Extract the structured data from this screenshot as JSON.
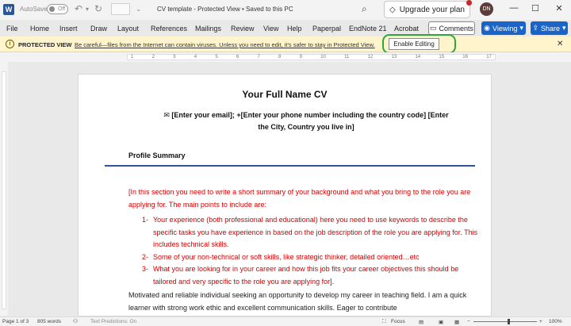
{
  "titlebar": {
    "app_logo": "W",
    "autosave_label": "AutoSave",
    "autosave_state": "Off",
    "undo_icon": "undo-icon",
    "redo_icon": "redo-icon",
    "doc_title": "CV template  -  Protected View  •  Saved to this PC",
    "upgrade_label": "Upgrade your plan",
    "avatar_initials": "DN",
    "minimize": "—",
    "maximize": "☐",
    "close": "✕"
  },
  "ribbon": {
    "tabs": [
      "File",
      "Home",
      "Insert",
      "Draw",
      "Layout",
      "References",
      "Mailings",
      "Review",
      "View",
      "Help",
      "Paperpal",
      "EndNote 21",
      "Acrobat"
    ],
    "comments_label": "Comments",
    "viewing_label": "Viewing",
    "share_label": "Share"
  },
  "protected_view": {
    "label": "PROTECTED VIEW",
    "message": "Be careful—files from the Internet can contain viruses. Unless you need to edit, it's safer to stay in Protected View.",
    "enable_label": "Enable Editing",
    "close": "✕"
  },
  "ruler": {
    "marks": [
      "1",
      "2",
      "3",
      "4",
      "5",
      "6",
      "7",
      "8",
      "9",
      "10",
      "11",
      "12",
      "13",
      "14",
      "15",
      "16",
      "17"
    ]
  },
  "document": {
    "name": "Your Full Name CV",
    "contact_line1": "[Enter your email];   +[Enter your phone number including the country code]    [Enter",
    "contact_line2": "the City,  Country you live in]",
    "section_title": "Profile Summary",
    "intro": "[In this section you need to write a short summary of your background and what you bring to the role you are applying for. The main points to include are:",
    "list": [
      {
        "num": "1-",
        "text": "Your experience (both professional and educational) here you need to use keywords to describe the specific tasks you have experience in based on the job description of the role you are applying for. This includes technical skills."
      },
      {
        "num": "2-",
        "text": "Some of your non-technical or soft skills, like strategic thinker, detailed oriented…etc"
      },
      {
        "num": "3-",
        "text": "What you are looking for in your career and how this job fits your career objectives this should be tailored and very specific to the role you are applying for]."
      }
    ],
    "paragraph": "Motivated and reliable individual seeking an opportunity to develop my career in teaching field. I am a quick learner with strong work ethic and excellent communication skills. Eager to contribute"
  },
  "statusbar": {
    "page": "Page 1 of 3",
    "words": "805 words",
    "predictions": "Text Predictions: On",
    "focus": "Focus",
    "zoom": "100%",
    "zoom_level_percent": 100
  },
  "colors": {
    "accent": "#1a64c7",
    "warning_bar": "#fff4cc",
    "highlight_ring": "#2ea83a",
    "red_text": "#d40000",
    "rule": "#2f5597"
  }
}
